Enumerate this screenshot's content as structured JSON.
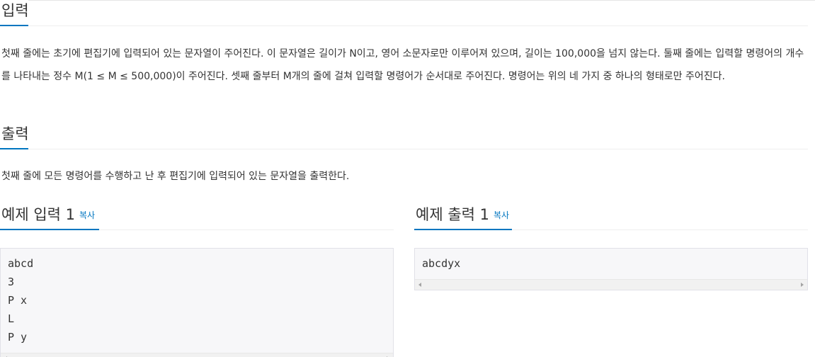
{
  "input_section": {
    "title": "입력",
    "description": "첫째 줄에는 초기에 편집기에 입력되어 있는 문자열이 주어진다. 이 문자열은 길이가 N이고, 영어 소문자로만 이루어져 있으며, 길이는 100,000을 넘지 않는다. 둘째 줄에는 입력할 명령어의 개수를 나타내는 정수 M(1 ≤ M ≤ 500,000)이 주어진다. 셋째 줄부터 M개의 줄에 걸쳐 입력할 명령어가 순서대로 주어진다. 명령어는 위의 네 가지 중 하나의 형태로만 주어진다."
  },
  "output_section": {
    "title": "출력",
    "description": "첫째 줄에 모든 명령어를 수행하고 난 후 편집기에 입력되어 있는 문자열을 출력한다."
  },
  "sample_input": {
    "title": "예제 입력 1",
    "copy_label": "복사",
    "lines": [
      "abcd",
      "3",
      "P x",
      "L",
      "P y"
    ]
  },
  "sample_output": {
    "title": "예제 출력 1",
    "copy_label": "복사",
    "lines": [
      "abcdyx"
    ]
  },
  "colors": {
    "accent": "#0076c0",
    "text": "#333333",
    "code_background": "#f7f7f9",
    "code_border": "#e1e1e8"
  }
}
